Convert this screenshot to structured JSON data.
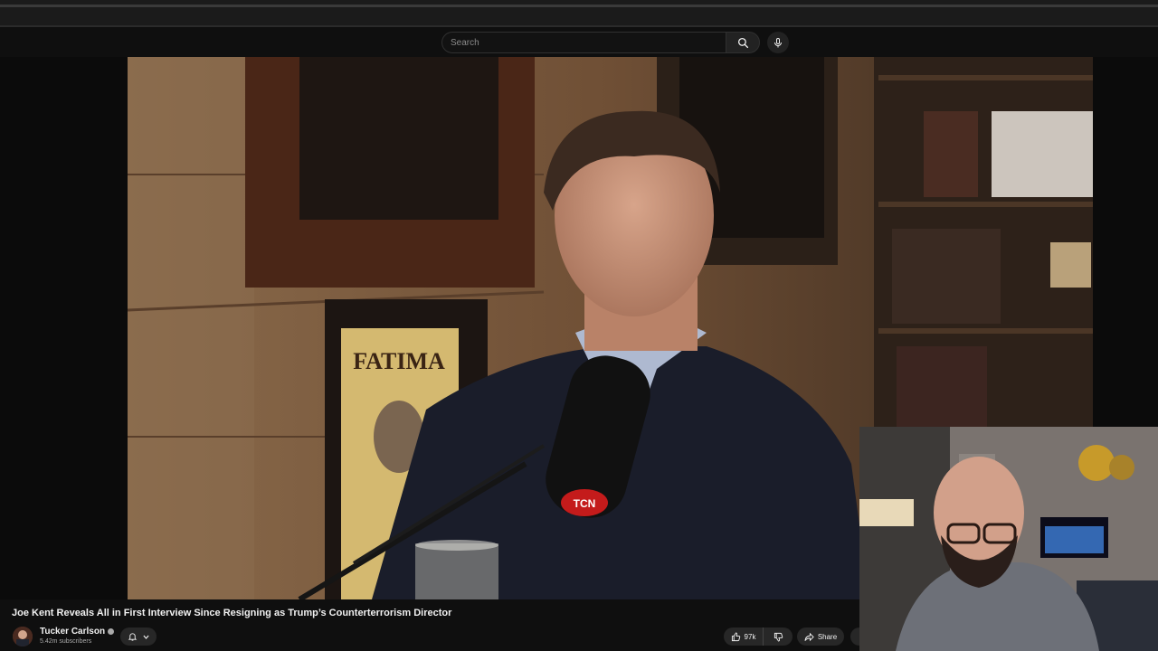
{
  "search": {
    "placeholder": "Search"
  },
  "video": {
    "title": "Joe Kent Reveals All in First Interview Since Resigning as Trump’s Counterterrorism Director",
    "poster_text": "FATIMA",
    "mic_logo": "TCN"
  },
  "channel": {
    "name": "Tucker Carlson",
    "subscribers": "5.42m subscribers"
  },
  "actions": {
    "like_count": "97k",
    "share_label": "Share"
  },
  "icons": {
    "search": "search-icon",
    "mic": "microphone-icon",
    "bell": "bell-icon",
    "chevron": "chevron-down-icon",
    "like": "thumbs-up-icon",
    "dislike": "thumbs-down-icon",
    "share": "share-arrow-icon",
    "verified": "verified-check-icon"
  },
  "colors": {
    "background": "#0f0f0f",
    "chip": "#272727",
    "text": "#f1f1f1",
    "muted": "#aaaaaa"
  }
}
